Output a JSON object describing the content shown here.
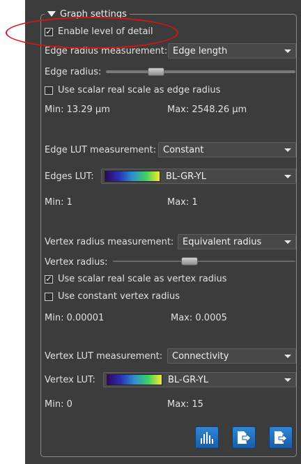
{
  "group": {
    "title": "Graph settings"
  },
  "level_of_detail": {
    "label": "Enable level of detail",
    "checked": true
  },
  "edge_radius": {
    "measurement_label": "Edge radius measurement:",
    "measurement_value": "Edge length",
    "radius_label": "Edge radius:",
    "slider_level": 0.25,
    "use_scalar_label": "Use scalar real scale as edge radius",
    "use_scalar_checked": false,
    "min_text": "Min:  13.29 μm",
    "max_text": "Max: 2548.26 μm"
  },
  "edge_lut": {
    "measurement_label": "Edge LUT measurement:",
    "measurement_value": "Constant",
    "lut_label": "Edges LUT:",
    "lut_value": "BL-GR-YL",
    "min_text": "Min:  1",
    "max_text": "Max: 1"
  },
  "vertex_radius": {
    "measurement_label": "Vertex radius measurement:",
    "measurement_value": "Equivalent radius",
    "radius_label": "Vertex radius:",
    "slider_level": 0.45,
    "use_scalar_label": "Use scalar real scale as vertex radius",
    "use_scalar_checked": true,
    "constant_label": "Use constant vertex radius",
    "constant_checked": false,
    "min_text": "Min:  0.00001",
    "max_text": "Max: 0.0005"
  },
  "vertex_lut": {
    "measurement_label": "Vertex LUT measurement:",
    "measurement_value": "Connectivity",
    "lut_label": "Vertex LUT:",
    "lut_value": "BL-GR-YL",
    "min_text": "Min:  0",
    "max_text": "Max: 15"
  },
  "toolbar": {
    "icons": [
      "histogram-icon",
      "export-icon",
      "export-alt-icon"
    ]
  },
  "colors": {
    "highlight": "#d81515",
    "panel_bg": "#3c3c3c",
    "button_blue": "#1f6fc0"
  }
}
